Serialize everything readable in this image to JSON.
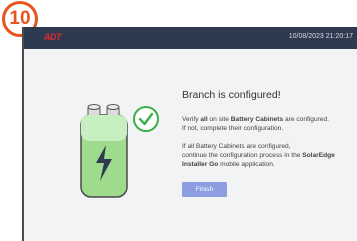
{
  "step_badge": "10",
  "header": {
    "logo_text": "ADT",
    "datetime": "10/08/2023 21:20:17"
  },
  "content": {
    "title": "Branch is configured!",
    "p1": {
      "a": "Verify ",
      "b": "all",
      "c": " on site ",
      "d": "Battery Cabinets",
      "e": " are configured.",
      "f": "If not, complete their configuration."
    },
    "p2": {
      "a": "If all Battery Cabinets are configured,",
      "b": "continue the configuration process in the ",
      "c": "SolarEdge Installer Go",
      "d": " mobile application."
    },
    "finish_label": "Finish"
  },
  "colors": {
    "accent": "#8c9de0",
    "topbar": "#2e3a4f",
    "badge": "#e8541e",
    "check": "#3bb04a"
  }
}
